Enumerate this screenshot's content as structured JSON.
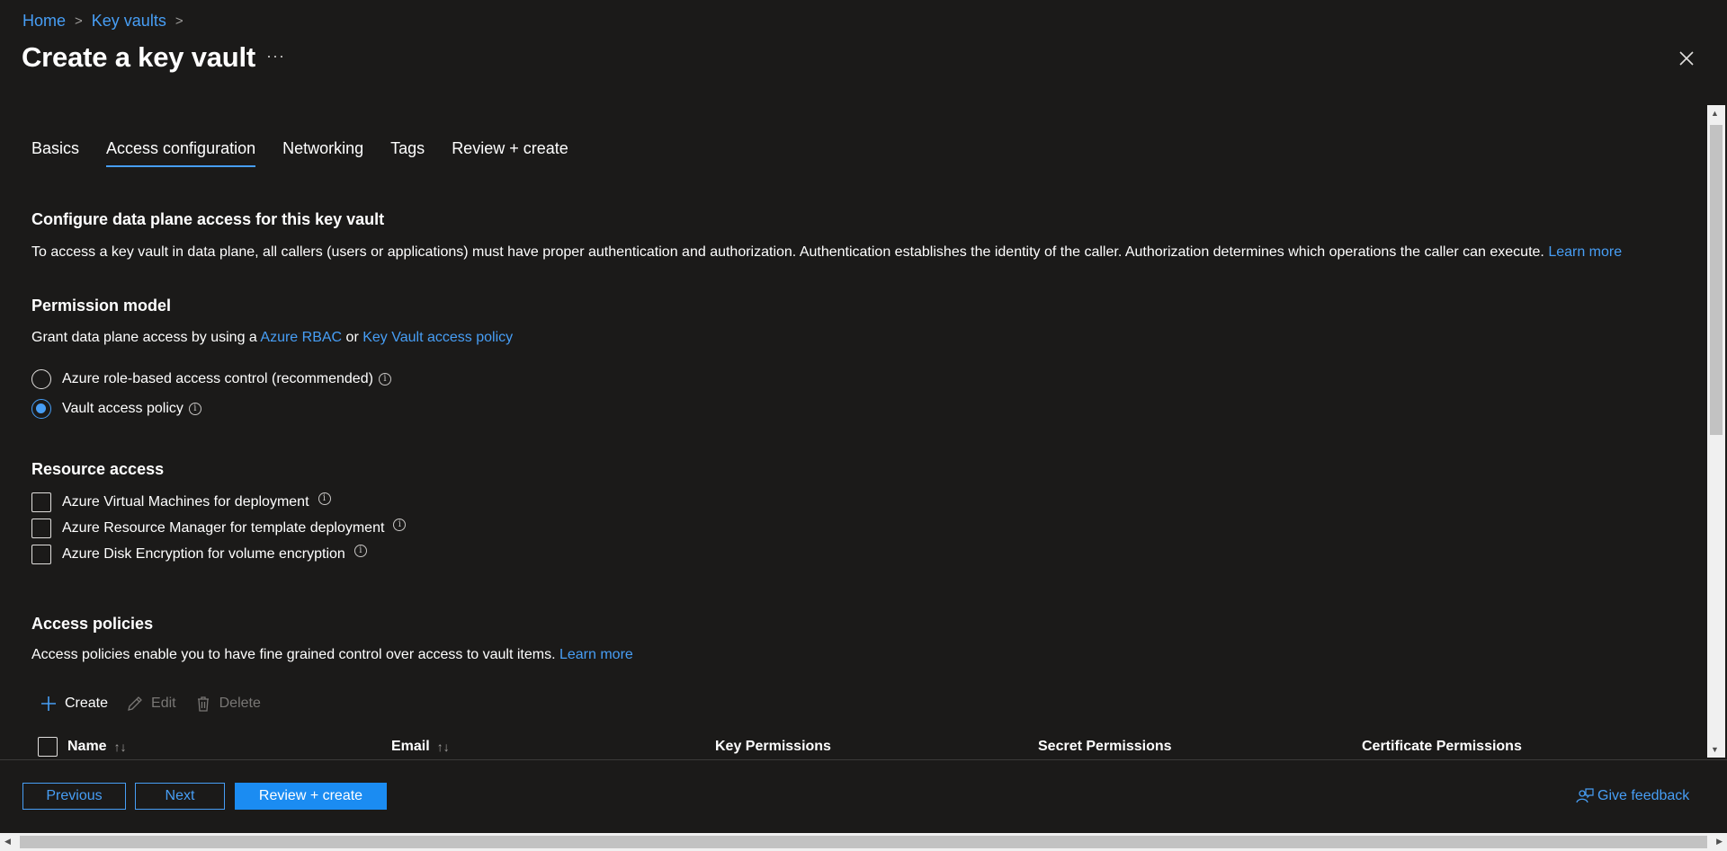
{
  "breadcrumb": {
    "items": [
      "Home",
      "Key vaults"
    ],
    "separator": ">"
  },
  "title": "Create a key vault",
  "more_label": "···",
  "tabs": [
    "Basics",
    "Access configuration",
    "Networking",
    "Tags",
    "Review + create"
  ],
  "active_tab": "Access configuration",
  "data_plane": {
    "heading": "Configure data plane access for this key vault",
    "description": "To access a key vault in data plane, all callers (users or applications) must have proper authentication and authorization. Authentication establishes the identity of the caller. Authorization determines which operations the caller can execute.",
    "learn_more": "Learn more"
  },
  "permission_model": {
    "heading": "Permission model",
    "grant_prefix": "Grant data plane access by using a",
    "rbac_link": "Azure RBAC",
    "or": "or",
    "policy_link": "Key Vault access policy",
    "options": [
      {
        "label": "Azure role-based access control (recommended)",
        "checked": false
      },
      {
        "label": "Vault access policy",
        "checked": true
      }
    ]
  },
  "resource_access": {
    "heading": "Resource access",
    "options": [
      {
        "label": "Azure Virtual Machines for deployment",
        "checked": false
      },
      {
        "label": "Azure Resource Manager for template deployment",
        "checked": false
      },
      {
        "label": "Azure Disk Encryption for volume encryption",
        "checked": false
      }
    ]
  },
  "access_policies": {
    "heading": "Access policies",
    "description": "Access policies enable you to have fine grained control over access to vault items.",
    "learn_more": "Learn more",
    "toolbar": {
      "create": "Create",
      "edit": "Edit",
      "delete": "Delete"
    },
    "columns": [
      "Name",
      "Email",
      "Key Permissions",
      "Secret Permissions",
      "Certificate Permissions"
    ]
  },
  "footer": {
    "previous": "Previous",
    "next": "Next",
    "review_create": "Review + create",
    "feedback": "Give feedback"
  },
  "colors": {
    "accent": "#479ef5",
    "primary_button": "#1b8cf2",
    "background": "#1b1a19"
  }
}
